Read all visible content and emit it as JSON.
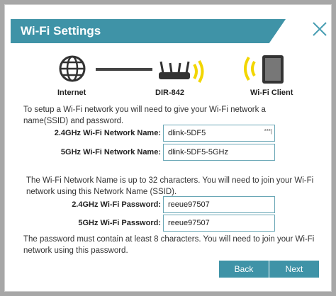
{
  "dialog": {
    "title": "Wi-Fi Settings"
  },
  "diagram": {
    "internet_label": "Internet",
    "router_label": "DIR-842",
    "client_label": "Wi-Fi Client"
  },
  "intro_text": "To setup a Wi-Fi network you will need to give your Wi-Fi network a name(SSID) and password.",
  "fields": {
    "ssid_24": {
      "label": "2.4GHz Wi-Fi Network Name:",
      "value": "dlink-5DF5",
      "hint": "***|"
    },
    "ssid_5": {
      "label": "5GHz Wi-Fi Network Name:",
      "value": "dlink-5DF5-5GHz"
    },
    "pw_24": {
      "label": "2.4GHz Wi-Fi Password:",
      "value": "reeue97507"
    },
    "pw_5": {
      "label": "5GHz Wi-Fi Password:",
      "value": "reeue97507"
    }
  },
  "ssid_note": "The Wi-Fi Network Name is up to 32 characters. You will need to join your Wi-Fi network using this Network Name (SSID).",
  "password_note": "The password must contain at least 8 characters. You will need to join your Wi-Fi network using this password.",
  "buttons": {
    "back": "Back",
    "next": "Next"
  },
  "colors": {
    "accent": "#3f93a7",
    "wifi_yellow": "#f2d600"
  }
}
